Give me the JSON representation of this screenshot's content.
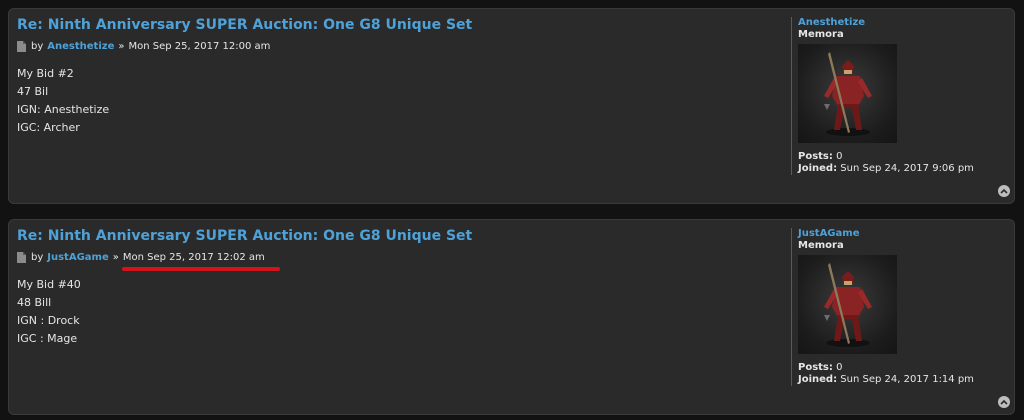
{
  "posts": [
    {
      "title": "Re: Ninth Anniversary SUPER Auction: One G8 Unique Set",
      "by": "by",
      "author": "Anesthetize",
      "separator": "»",
      "date": "Mon Sep 25, 2017 12:00 am",
      "content": [
        "My Bid #2",
        "47 Bil",
        "IGN: Anesthetize",
        "IGC: Archer"
      ],
      "profile": {
        "username": "Anesthetize",
        "rank": "Memora",
        "posts_label": "Posts:",
        "posts_value": "0",
        "joined_label": "Joined:",
        "joined_value": "Sun Sep 24, 2017 9:06 pm"
      }
    },
    {
      "title": "Re: Ninth Anniversary SUPER Auction: One G8 Unique Set",
      "by": "by",
      "author": "JustAGame",
      "separator": "»",
      "date": "Mon Sep 25, 2017 12:02 am",
      "content": [
        "My Bid #40",
        "48 Bill",
        "IGN : Drock",
        "IGC : Mage"
      ],
      "profile": {
        "username": "JustAGame",
        "rank": "Memora",
        "posts_label": "Posts:",
        "posts_value": "0",
        "joined_label": "Joined:",
        "joined_value": "Sun Sep 24, 2017 1:14 pm"
      }
    }
  ],
  "colors": {
    "link": "#4fa2d8",
    "background": "#2a2a2a",
    "page": "#121212",
    "highlight": "#d4141a"
  },
  "icons": {
    "post": "document-icon",
    "top": "chevron-up-icon",
    "avatar": "armored-knight-avatar"
  }
}
